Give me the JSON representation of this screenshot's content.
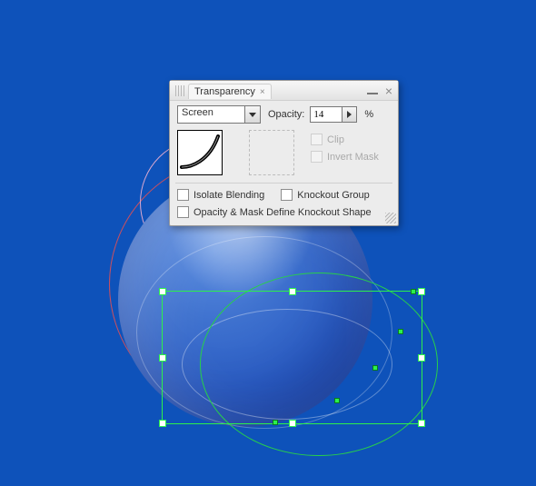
{
  "panel": {
    "title": "Transparency",
    "blend_mode": "Screen",
    "opacity_label": "Opacity:",
    "opacity_value": "14",
    "opacity_suffix": "%",
    "clip_label": "Clip",
    "invert_mask_label": "Invert Mask",
    "isolate_label": "Isolate Blending",
    "knockout_label": "Knockout Group",
    "opacity_mask_define_label": "Opacity & Mask Define Knockout Shape"
  },
  "colors": {
    "canvas_bg": "#0e52ba",
    "selection": "#2cf04c"
  }
}
